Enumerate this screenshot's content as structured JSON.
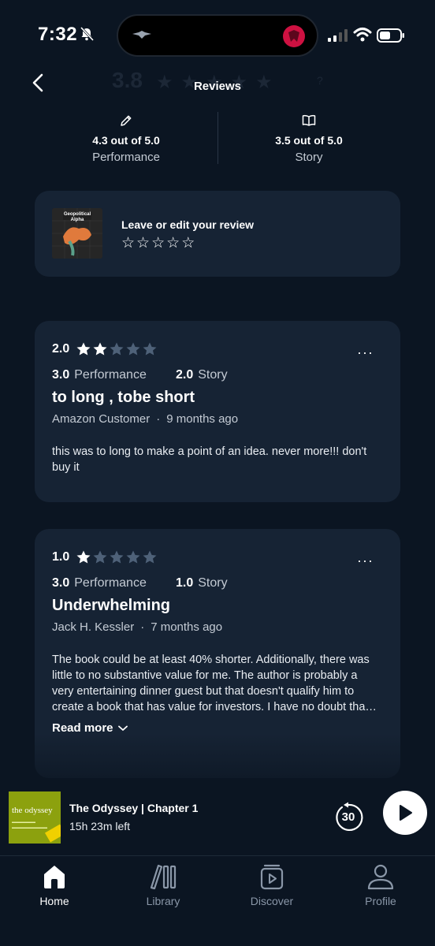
{
  "status": {
    "time": "7:32"
  },
  "header": {
    "title": "Reviews",
    "ghost_rating": "3.8",
    "ghost_q": "?"
  },
  "summary": {
    "performance": {
      "score": "4.3 out of 5.0",
      "label": "Performance",
      "icon": "pencil-icon"
    },
    "story": {
      "score": "3.5 out of 5.0",
      "label": "Story",
      "icon": "open-book-icon"
    }
  },
  "leave_review": {
    "title": "Leave or edit your review",
    "star_glyph": "☆",
    "cover": {
      "title": "Geopolitical Alpha"
    }
  },
  "reviews": [
    {
      "overall": "2.0",
      "filled_stars": 2,
      "performance_score": "3.0",
      "performance_label": "Performance",
      "story_score": "2.0",
      "story_label": "Story",
      "title": "to long , tobe short",
      "author": "Amazon Customer",
      "dot": "·",
      "date": "9 months ago",
      "body": "this was to long to make a point of an idea. never more!!! don't buy it",
      "more": "···"
    },
    {
      "overall": "1.0",
      "filled_stars": 1,
      "performance_score": "3.0",
      "performance_label": "Performance",
      "story_score": "1.0",
      "story_label": "Story",
      "title": "Underwhelming",
      "author": "Jack H. Kessler",
      "dot": "·",
      "date": "7 months ago",
      "body": "The book could be at least 40% shorter. Additionally, there was little to no substantive value for me. The author is probably a very entertaining dinner guest but that doesn't qualify him to create a book that has value for investors. I have no doubt tha…",
      "read_more": "Read more",
      "more": "···"
    }
  ],
  "player": {
    "title": "The Odyssey | Chapter 1",
    "time_left": "15h 23m left",
    "skip_seconds": "30",
    "cover_title": "the odyssey"
  },
  "tabs": [
    {
      "label": "Home",
      "icon": "home-icon",
      "active": true
    },
    {
      "label": "Library",
      "icon": "library-icon",
      "active": false
    },
    {
      "label": "Discover",
      "icon": "discover-icon",
      "active": false
    },
    {
      "label": "Profile",
      "icon": "profile-icon",
      "active": false
    }
  ],
  "colors": {
    "background": "#0b1522",
    "card": "#162334",
    "star_filled": "#ffffff",
    "star_empty": "#4e6178",
    "muted_text": "#c4cbd4"
  }
}
